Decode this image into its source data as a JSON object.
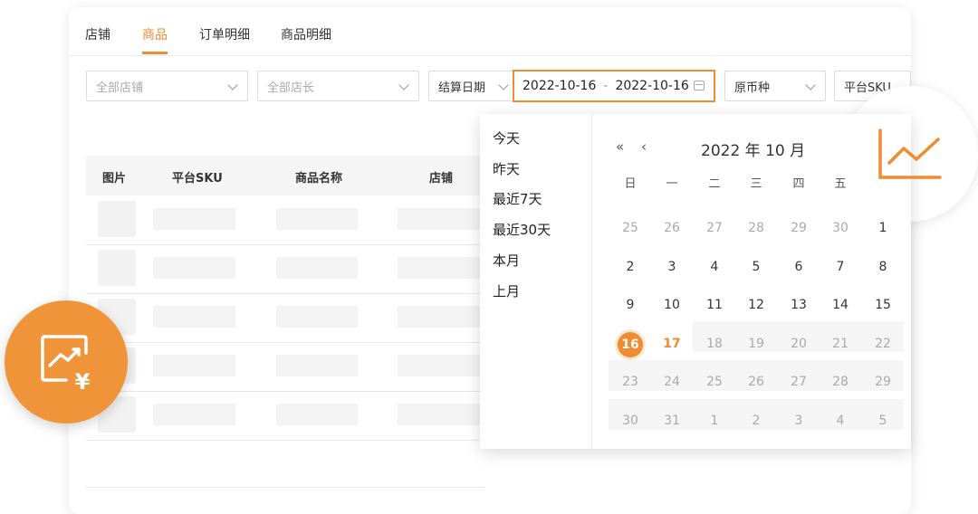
{
  "tabs": [
    "店铺",
    "商品",
    "订单明细",
    "商品明细"
  ],
  "active_tab": "商品",
  "filters": {
    "store": "全部店铺",
    "manager": "全部店长",
    "date_type": "结算日期",
    "date_start": "2022-10-16",
    "date_sep": "-",
    "date_end": "2022-10-16",
    "currency": "原币种",
    "sku": "平台SKU"
  },
  "table": {
    "columns": [
      "图片",
      "平台SKU",
      "商品名称",
      "店铺"
    ]
  },
  "date_picker": {
    "shortcuts": [
      "今天",
      "昨天",
      "最近7天",
      "最近30天",
      "本月",
      "上月"
    ],
    "nav_prev_year": "«",
    "nav_prev_month": "‹",
    "month_title": "2022 年 10 月",
    "weekdays": [
      "日",
      "一",
      "二",
      "三",
      "四",
      "五"
    ],
    "weeks": [
      [
        "25",
        "26",
        "27",
        "28",
        "29",
        "30",
        "1"
      ],
      [
        "2",
        "3",
        "4",
        "5",
        "6",
        "7",
        "8"
      ],
      [
        "9",
        "10",
        "11",
        "12",
        "13",
        "14",
        "15"
      ],
      [
        "16",
        "17",
        "18",
        "19",
        "20",
        "21",
        "22"
      ],
      [
        "23",
        "24",
        "25",
        "26",
        "27",
        "28",
        "29"
      ],
      [
        "30",
        "31",
        "1",
        "2",
        "3",
        "4",
        "5"
      ]
    ],
    "selected_day": "16",
    "today": "17"
  },
  "icons": {
    "left_badge": "chart-yuan-icon",
    "right_badge": "trend-line-icon"
  },
  "colors": {
    "accent": "#ef8c33",
    "badge": "#f0943a"
  }
}
